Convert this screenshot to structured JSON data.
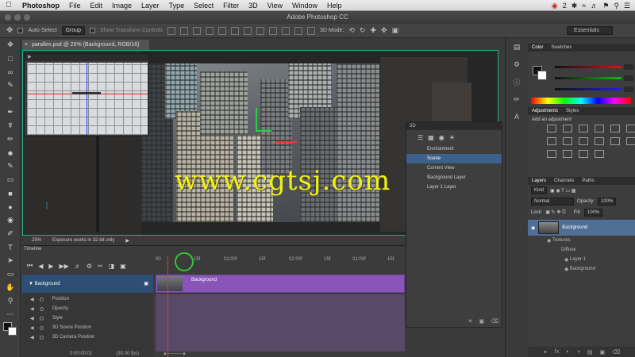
{
  "menubar": {
    "app": "Photoshop",
    "items": [
      "File",
      "Edit",
      "Image",
      "Layer",
      "Type",
      "Select",
      "Filter",
      "3D",
      "View",
      "Window",
      "Help"
    ],
    "status_num": "2"
  },
  "window": {
    "title": "Adobe Photoshop CC"
  },
  "options": {
    "auto_select": "Auto-Select",
    "group": "Group",
    "show_transform": "Show Transform Controls",
    "mode_3d": "3D Mode:",
    "workspace": "Essentials"
  },
  "document": {
    "tab_title": "parallex.psd @ 25% (Background, RGB/16)",
    "zoom": "25%",
    "status_msg": "Exposure works in 32-bit only"
  },
  "watermark": "www.cgtsj.com",
  "timeline": {
    "tab": "Timeline",
    "ruler": [
      "00",
      "15f",
      "01:00f",
      "15f",
      "02:00f",
      "15f",
      "01:00f",
      "15f"
    ],
    "layer_name": "Background",
    "clip_name": "Background",
    "properties": [
      "Position",
      "Opacity",
      "Style",
      "3D Scene Position",
      "3D Camera Position"
    ],
    "timecode": "0:00:00:01",
    "fps": "(30.00 fps)"
  },
  "panel3d": {
    "title": "3D",
    "rows": [
      "Environment",
      "Scene",
      "Current View",
      "Background Layer",
      "Layer 1 Layer"
    ]
  },
  "color_panel": {
    "tabs": [
      "Color",
      "Swatches"
    ]
  },
  "adjustments": {
    "tabs": [
      "Adjustments",
      "Styles"
    ],
    "title": "Add an adjustment"
  },
  "layers_panel": {
    "tabs": [
      "Layers",
      "Channels",
      "Paths"
    ],
    "kind": "Kind",
    "blend": "Normal",
    "opacity_label": "Opacity:",
    "opacity": "100%",
    "lock_label": "Lock:",
    "fill_label": "Fill:",
    "fill": "100%",
    "layer": "Background",
    "sub": [
      "Textures",
      "Diffuse",
      "Layer 1",
      "Background"
    ]
  }
}
